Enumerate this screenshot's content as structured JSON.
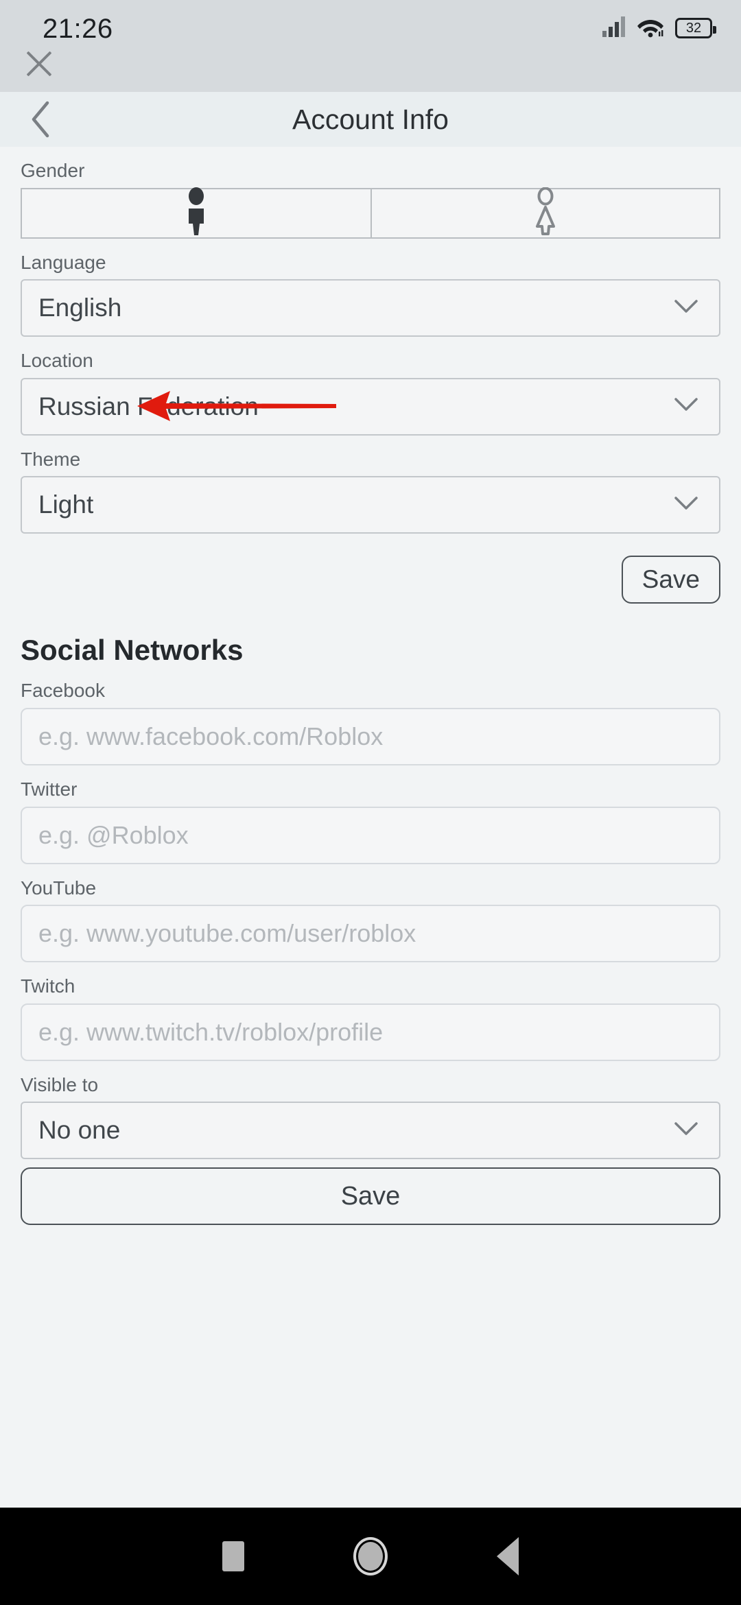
{
  "status_bar": {
    "time": "21:26",
    "battery_level": "32",
    "signal_icon": "cellular-signal-icon",
    "wifi_icon": "wifi-icon"
  },
  "overlay": {
    "close_icon": "close-icon"
  },
  "appbar": {
    "title": "Account Info",
    "back_icon": "back-chevron-icon"
  },
  "account_info": {
    "gender": {
      "label": "Gender",
      "options": [
        {
          "icon": "male-figure-icon",
          "selected": true
        },
        {
          "icon": "female-figure-icon",
          "selected": false
        }
      ]
    },
    "language": {
      "label": "Language",
      "value": "English"
    },
    "location": {
      "label": "Location",
      "value": "Russian Federation"
    },
    "theme": {
      "label": "Theme",
      "value": "Light"
    },
    "save_label": "Save"
  },
  "social_networks": {
    "title": "Social Networks",
    "fields": [
      {
        "label": "Facebook",
        "value": "",
        "placeholder": "e.g. www.facebook.com/Roblox"
      },
      {
        "label": "Twitter",
        "value": "",
        "placeholder": "e.g. @Roblox"
      },
      {
        "label": "YouTube",
        "value": "",
        "placeholder": "e.g. www.youtube.com/user/roblox"
      },
      {
        "label": "Twitch",
        "value": "",
        "placeholder": "e.g. www.twitch.tv/roblox/profile"
      }
    ],
    "visible_to": {
      "label": "Visible to",
      "value": "No one"
    },
    "save_label": "Save"
  },
  "annotation": {
    "arrow_color": "#e01b0e",
    "points_to": "language-dropdown"
  },
  "nav_bar": {
    "recents_icon": "square-recents-icon",
    "home_icon": "circle-home-icon",
    "back_icon": "triangle-back-icon"
  },
  "colors": {
    "status_bar_bg": "#d6dadd",
    "appbar_bg": "#e9eef0",
    "page_bg": "#f2f4f5",
    "border": "#c3c7cb",
    "text": "#40464b",
    "label": "#5d6368",
    "placeholder": "#b3b7bb",
    "accent_red": "#e01b0e",
    "nav_bg": "#000000"
  }
}
